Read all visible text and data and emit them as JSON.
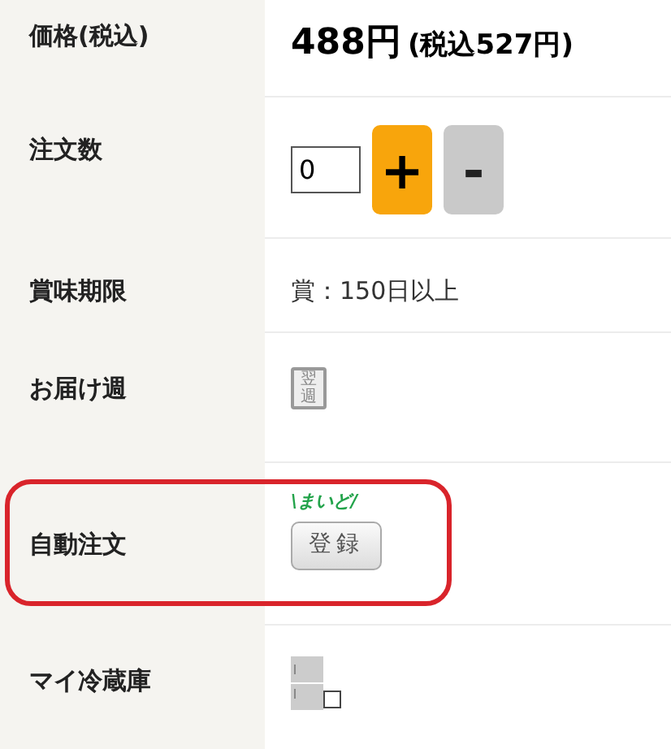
{
  "rows": [
    {
      "kind": "price",
      "label": "価格(税込)",
      "price": "488円",
      "tax_note": "(税込527円)"
    },
    {
      "kind": "quantity",
      "label": "注文数",
      "value": "0",
      "plus": "+",
      "minus": "-"
    },
    {
      "kind": "text",
      "label": "賞味期限",
      "text": "賞：150日以上"
    },
    {
      "kind": "week",
      "label": "お届け週",
      "badge": "翌週"
    },
    {
      "kind": "auto",
      "label": "自動注文",
      "caption": "\\まいど/",
      "button": "登録",
      "highlighted": true
    },
    {
      "kind": "fridge",
      "label": "マイ冷蔵庫"
    }
  ]
}
